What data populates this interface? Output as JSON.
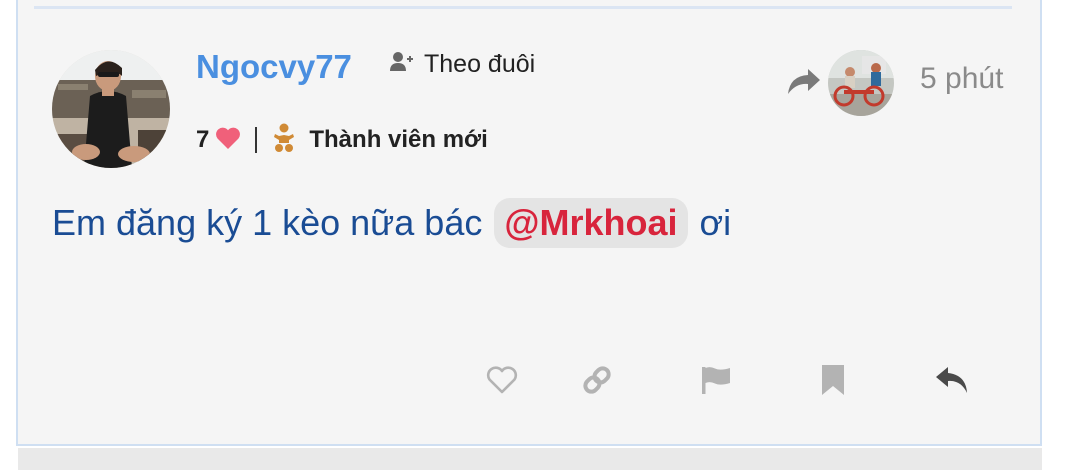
{
  "post": {
    "author": {
      "username": "Ngocvy77",
      "likes": "7",
      "rank": "Thành viên mới"
    },
    "follow_label": "Theo đuôi",
    "time": "5 phút",
    "body": {
      "text_before": "Em đăng ký 1 kèo nữa bác",
      "mention": "@Mrkhoai",
      "text_after": "ơi"
    }
  },
  "colors": {
    "username": "#4a8fe0",
    "body_text": "#1a4c94",
    "mention": "#d8243c",
    "heart": "#f0607a",
    "rank_icon": "#d08a35",
    "icon_gray": "#b3b3b3",
    "reply_icon": "#4a4a4a"
  },
  "icons": {
    "follow": "user-plus-icon",
    "likes": "heart-icon",
    "rank": "baby-icon",
    "reply_to": "share-arrow-icon",
    "actions": [
      "heart-outline-icon",
      "link-icon",
      "flag-icon",
      "bookmark-icon",
      "reply-icon"
    ]
  }
}
